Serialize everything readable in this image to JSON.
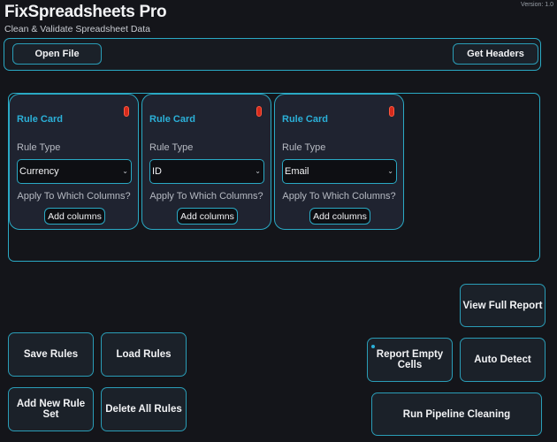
{
  "app": {
    "title": "FixSpreadsheets Pro",
    "subtitle": "Clean & Validate Spreadsheet Data",
    "version": "Version: 1.0"
  },
  "toolbar": {
    "open_file": "Open File",
    "get_headers": "Get Headers"
  },
  "rule_cards": [
    {
      "title": "Rule Card",
      "rule_type_label": "Rule Type",
      "rule_type_value": "Currency",
      "apply_label": "Apply To Which Columns?",
      "add_columns": "Add columns"
    },
    {
      "title": "Rule Card",
      "rule_type_label": "Rule Type",
      "rule_type_value": "ID",
      "apply_label": "Apply To Which Columns?",
      "add_columns": "Add columns"
    },
    {
      "title": "Rule Card",
      "rule_type_label": "Rule Type",
      "rule_type_value": "Email",
      "apply_label": "Apply To Which Columns?",
      "add_columns": "Add columns"
    }
  ],
  "actions": {
    "save_rules": "Save Rules",
    "load_rules": "Load Rules",
    "add_new_rule_set": "Add New Rule Set",
    "delete_all_rules": "Delete All Rules",
    "view_full_report": "View Full Report",
    "report_empty_cells": "Report Empty Cells",
    "auto_detect": "Auto Detect",
    "run_pipeline_cleaning": "Run Pipeline Cleaning"
  },
  "colors": {
    "background": "#14151a",
    "accent_border": "#2aa9c4",
    "card_title": "#2bb0d8",
    "close_pill": "#d52a1c"
  }
}
